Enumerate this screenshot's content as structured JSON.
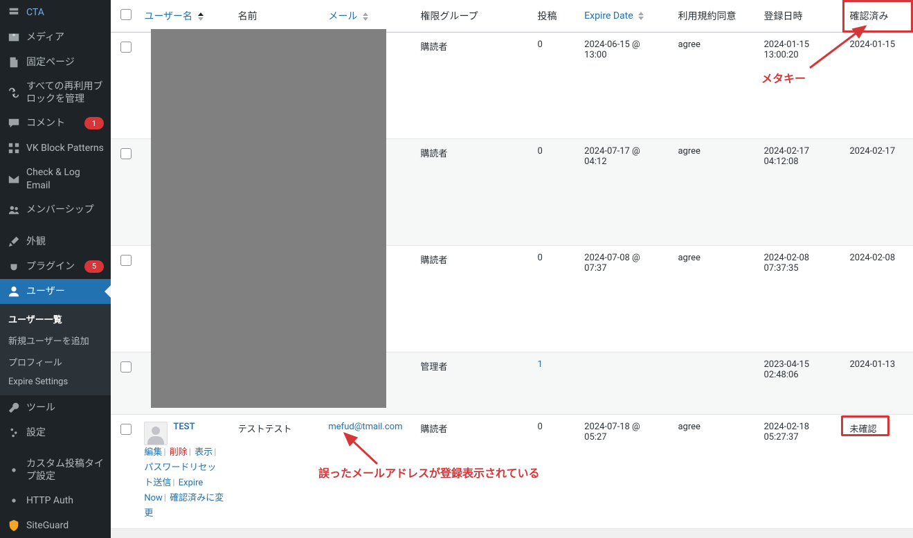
{
  "sidebar": {
    "items": [
      {
        "icon": "cta",
        "label": "CTA"
      },
      {
        "icon": "media",
        "label": "メディア"
      },
      {
        "icon": "page",
        "label": "固定ページ"
      },
      {
        "icon": "reusable",
        "label": "すべての再利用ブロックを管理"
      },
      {
        "icon": "comment",
        "label": "コメント",
        "badge": "1"
      },
      {
        "icon": "vk",
        "label": "VK Block Patterns"
      },
      {
        "icon": "mail",
        "label": "Check & Log Email"
      },
      {
        "icon": "group",
        "label": "メンバーシップ"
      },
      {
        "icon": "appearance",
        "label": "外観"
      },
      {
        "icon": "plugin",
        "label": "プラグイン",
        "badge": "5"
      },
      {
        "icon": "user",
        "label": "ユーザー"
      },
      {
        "icon": "tools",
        "label": "ツール"
      },
      {
        "icon": "settings",
        "label": "設定"
      },
      {
        "icon": "settings",
        "label": "カスタム投稿タイプ設定"
      },
      {
        "icon": "settings",
        "label": "HTTP Auth"
      },
      {
        "icon": "siteguard",
        "label": "SiteGuard"
      }
    ],
    "sub_users": {
      "list": "ユーザー一覧",
      "add": "新規ユーザーを追加",
      "profile": "プロフィール",
      "expire": "Expire Settings"
    }
  },
  "table": {
    "headers": {
      "username": "ユーザー名",
      "name": "名前",
      "email": "メール",
      "role": "権限グループ",
      "posts": "投稿",
      "expire": "Expire Date",
      "agree": "利用規約同意",
      "registered": "登録日時",
      "confirmed": "確認済み"
    },
    "rows": [
      {
        "role": "購読者",
        "posts": "0",
        "expire": "2024-06-15 @ 13:00",
        "agree": "agree",
        "registered": "2024-01-15 13:00:20",
        "confirmed": "2024-01-15"
      },
      {
        "role": "購読者",
        "posts": "0",
        "expire": "2024-07-17 @ 04:12",
        "agree": "agree",
        "registered": "2024-02-17 04:12:08",
        "confirmed": "2024-02-17"
      },
      {
        "role": "購読者",
        "posts": "0",
        "expire": "2024-07-08 @ 07:37",
        "agree": "agree",
        "registered": "2024-02-08 07:37:35",
        "confirmed": "2024-02-08"
      },
      {
        "role": "管理者",
        "posts": "1",
        "posts_link": true,
        "expire": "",
        "agree": "",
        "registered": "2023-04-15 02:48:06",
        "confirmed": "2024-01-13"
      },
      {
        "username": "TEST",
        "name": "テストテスト",
        "email": "mefud@tmail.com",
        "role": "購読者",
        "posts": "0",
        "expire": "2024-07-18 @ 05:27",
        "agree": "agree",
        "registered": "2024-02-18 05:27:37",
        "confirmed": "未確認",
        "actions": {
          "edit": "編集",
          "delete": "削除",
          "view": "表示",
          "passreset": "パスワードリセット送信",
          "expirenow": "Expire Now",
          "markconfirmed": "確認済みに変更"
        }
      }
    ]
  },
  "annotations": {
    "metakey": "メタキー",
    "wrong_email": "誤ったメールアドレスが登録表示されている",
    "unconfirmed_box_label": "未確認"
  }
}
